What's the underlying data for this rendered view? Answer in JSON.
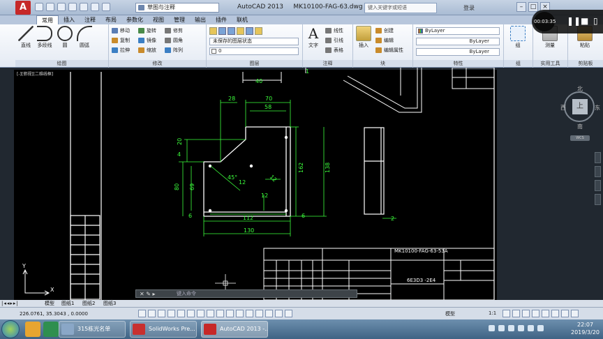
{
  "title_bar": {
    "app_logo": "A",
    "workspace": "草图与注释",
    "app_name": "AutoCAD 2013",
    "file_name": "MK10100-FAG-63.dwg",
    "search_placeholder": "键入关键字或短语",
    "sign_in": "登录"
  },
  "ribbon_tabs": [
    "常用",
    "插入",
    "注释",
    "布局",
    "参数化",
    "视图",
    "管理",
    "输出",
    "插件",
    "联机"
  ],
  "ribbon": {
    "draw": {
      "line": "直线",
      "polyline": "多段线",
      "circle": "圆",
      "arc": "圆弧",
      "title": "绘图"
    },
    "modify": {
      "move": "移动",
      "rotate": "旋转",
      "trim": "修剪",
      "copy": "复制",
      "mirror": "镜像",
      "fillet": "圆角",
      "stretch": "拉伸",
      "scale": "缩放",
      "array": "阵列",
      "title": "修改"
    },
    "layers": {
      "state": "未保存的图层状态",
      "current": "0",
      "title": "图层"
    },
    "annotation": {
      "text": "文字",
      "linear": "线性",
      "leader": "引线",
      "table": "表格",
      "title": "注释"
    },
    "block": {
      "insert": "插入",
      "create": "创建",
      "edit": "编辑",
      "edit_attr": "编辑属性",
      "title": "块"
    },
    "properties": {
      "color": "ByLayer",
      "linetype": "ByLayer",
      "lineweight": "ByLayer",
      "title": "特性"
    },
    "groups": {
      "group": "组",
      "title": "组"
    },
    "utilities": {
      "measure": "测量",
      "title": "实用工具"
    },
    "clipboard": {
      "paste": "粘贴",
      "title": "剪贴板"
    }
  },
  "viewport_label": "[-][俯视][二维线框]",
  "viewcube": {
    "north": "北",
    "south": "南",
    "west": "西",
    "east": "东",
    "face": "上",
    "wcs": "WCS"
  },
  "drawing": {
    "dims": [
      "70",
      "58",
      "28",
      "20",
      "4",
      "162",
      "138",
      "12",
      "12",
      "80",
      "69",
      "12",
      "112",
      "130",
      "6",
      "6",
      "45°",
      "40",
      "2",
      "1"
    ],
    "title_block": {
      "drawing_no": "MK10100-FAG-63-53A",
      "sub": "6E3D3 -2E4"
    }
  },
  "ucs": {
    "x": "X",
    "y": "Y"
  },
  "command_line": {
    "prompt": "键入命令"
  },
  "layout_tabs": [
    "模型",
    "图纸1",
    "图纸2",
    "图纸3"
  ],
  "status": {
    "coords": "226.0761, 35.3043 , 0.0000",
    "model": "模型",
    "scale": "1:1"
  },
  "recorder": {
    "time": "00:03:35"
  },
  "taskbar": {
    "item1": "315栋光名单",
    "item2": "SolidWorks Pre...",
    "item3": "AutoCAD 2013 -...",
    "time": "22:07",
    "date": "2019/3/20"
  },
  "colors": {
    "canvas": "#212830",
    "dimension": "#3cff3c",
    "geometry": "#ffffff",
    "ribbon": "#e4eaf3"
  }
}
